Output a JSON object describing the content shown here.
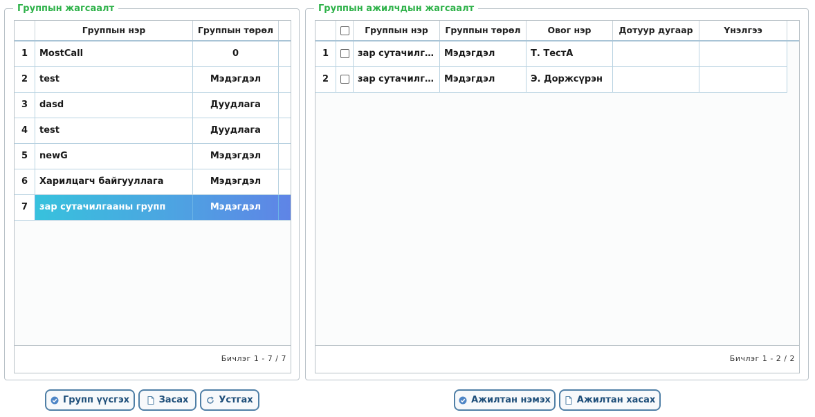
{
  "left_panel": {
    "legend": "Группын жагсаалт",
    "columns": [
      "Группын нэр",
      "Группын төрөл"
    ],
    "rows": [
      {
        "num": "1",
        "name": "MostCall",
        "type": "0"
      },
      {
        "num": "2",
        "name": "test",
        "type": "Мэдэгдэл"
      },
      {
        "num": "3",
        "name": "dasd",
        "type": "Дуудлага"
      },
      {
        "num": "4",
        "name": "test",
        "type": "Дуудлага"
      },
      {
        "num": "5",
        "name": "newG",
        "type": "Мэдэгдэл"
      },
      {
        "num": "6",
        "name": "Харилцагч байгууллага",
        "type": "Мэдэгдэл"
      },
      {
        "num": "7",
        "name": "зар сутачилгааны групп",
        "type": "Мэдэгдэл"
      }
    ],
    "selected_row": "7",
    "pager": "Бичлэг 1 - 7 / 7"
  },
  "right_panel": {
    "legend": "Группын ажилчдын жагсаалт",
    "columns": [
      "Группын нэр",
      "Группын төрөл",
      "Овог нэр",
      "Дотуур дугаар",
      "Үнэлгээ"
    ],
    "rows": [
      {
        "num": "1",
        "group": "зар сутачилгааны групп",
        "type": "Мэдэгдэл",
        "name": "Т. ТестА",
        "ext": "",
        "rating": ""
      },
      {
        "num": "2",
        "group": "зар сутачилгааны групп",
        "type": "Мэдэгдэл",
        "name": "Э. Доржсүрэн",
        "ext": "",
        "rating": ""
      }
    ],
    "pager": "Бичлэг 1 - 2 / 2"
  },
  "buttons": {
    "create_group": "Групп үүсгэх",
    "edit": "Засах",
    "delete": "Устгах",
    "add_employee": "Ажилтан нэмэх",
    "remove_employee": "Ажилтан хасах"
  },
  "icons": {
    "create_group": "check-circle-icon",
    "edit": "document-icon",
    "delete": "refresh-icon",
    "add_employee": "check-circle-icon",
    "remove_employee": "document-icon"
  },
  "colors": {
    "legend": "#2fb24a",
    "button_border": "#4f7fa6",
    "button_text": "#1f4f7a",
    "selection_start": "#34c6dc",
    "selection_end": "#5f84e6"
  }
}
